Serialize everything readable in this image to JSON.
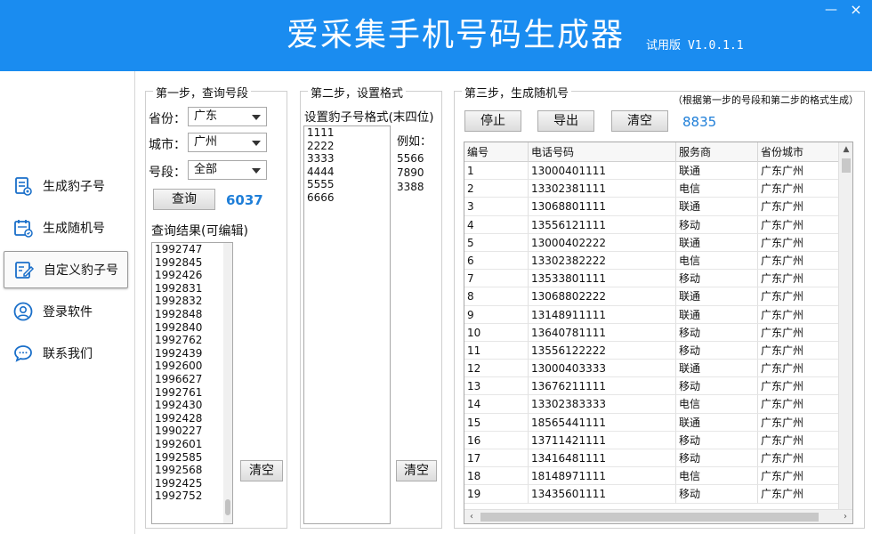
{
  "header": {
    "title": "爱采集手机号码生成器",
    "edition": "试用版",
    "version": "V1.0.1.1",
    "minimize": "—",
    "close": "×",
    "bg_color": "#1a8cf0"
  },
  "sidebar": {
    "items": [
      {
        "label": "生成豹子号",
        "icon": "document-icon"
      },
      {
        "label": "生成随机号",
        "icon": "calendar-icon"
      },
      {
        "label": "自定义豹子号",
        "icon": "edit-icon",
        "active": true
      },
      {
        "label": "登录软件",
        "icon": "user-icon"
      },
      {
        "label": "联系我们",
        "icon": "chat-icon"
      }
    ]
  },
  "step1": {
    "title": "第一步，查询号段",
    "province_label": "省份：",
    "province_value": "广东",
    "city_label": "城市：",
    "city_value": "广州",
    "segment_label": "号段：",
    "segment_value": "全部",
    "query_button": "查询",
    "count": "6037",
    "result_label": "查询结果(可编辑)",
    "results": [
      "1992747",
      "1992845",
      "1992426",
      "1992831",
      "1992832",
      "1992848",
      "1992840",
      "1992762",
      "1992439",
      "1992600",
      "1996627",
      "1992761",
      "1992430",
      "1992428",
      "1990227",
      "1992601",
      "1992585",
      "1992568",
      "1992425",
      "1992752"
    ],
    "clear_button": "清空"
  },
  "step2": {
    "title": "第二步，设置格式",
    "format_label": "设置豹子号格式(末四位)",
    "formats": [
      "1111",
      "2222",
      "3333",
      "4444",
      "5555",
      "6666"
    ],
    "example_label": "例如：",
    "examples": [
      "5566",
      "7890",
      "3388"
    ],
    "clear_button": "清空"
  },
  "step3": {
    "title": "第三步，生成随机号",
    "note": "（根据第一步的号段和第二步的格式生成）",
    "stop_button": "停止",
    "export_button": "导出",
    "clear_button": "清空",
    "count": "8835",
    "columns": [
      "编号",
      "电话号码",
      "服务商",
      "省份城市"
    ],
    "rows": [
      [
        "1",
        "13000401111",
        "联通",
        "广东广州"
      ],
      [
        "2",
        "13302381111",
        "电信",
        "广东广州"
      ],
      [
        "3",
        "13068801111",
        "联通",
        "广东广州"
      ],
      [
        "4",
        "13556121111",
        "移动",
        "广东广州"
      ],
      [
        "5",
        "13000402222",
        "联通",
        "广东广州"
      ],
      [
        "6",
        "13302382222",
        "电信",
        "广东广州"
      ],
      [
        "7",
        "13533801111",
        "移动",
        "广东广州"
      ],
      [
        "8",
        "13068802222",
        "联通",
        "广东广州"
      ],
      [
        "9",
        "13148911111",
        "联通",
        "广东广州"
      ],
      [
        "10",
        "13640781111",
        "移动",
        "广东广州"
      ],
      [
        "11",
        "13556122222",
        "移动",
        "广东广州"
      ],
      [
        "12",
        "13000403333",
        "联通",
        "广东广州"
      ],
      [
        "13",
        "13676211111",
        "移动",
        "广东广州"
      ],
      [
        "14",
        "13302383333",
        "电信",
        "广东广州"
      ],
      [
        "15",
        "18565441111",
        "联通",
        "广东广州"
      ],
      [
        "16",
        "13711421111",
        "移动",
        "广东广州"
      ],
      [
        "17",
        "13416481111",
        "移动",
        "广东广州"
      ],
      [
        "18",
        "18148971111",
        "电信",
        "广东广州"
      ],
      [
        "19",
        "13435601111",
        "移动",
        "广东广州"
      ]
    ]
  }
}
